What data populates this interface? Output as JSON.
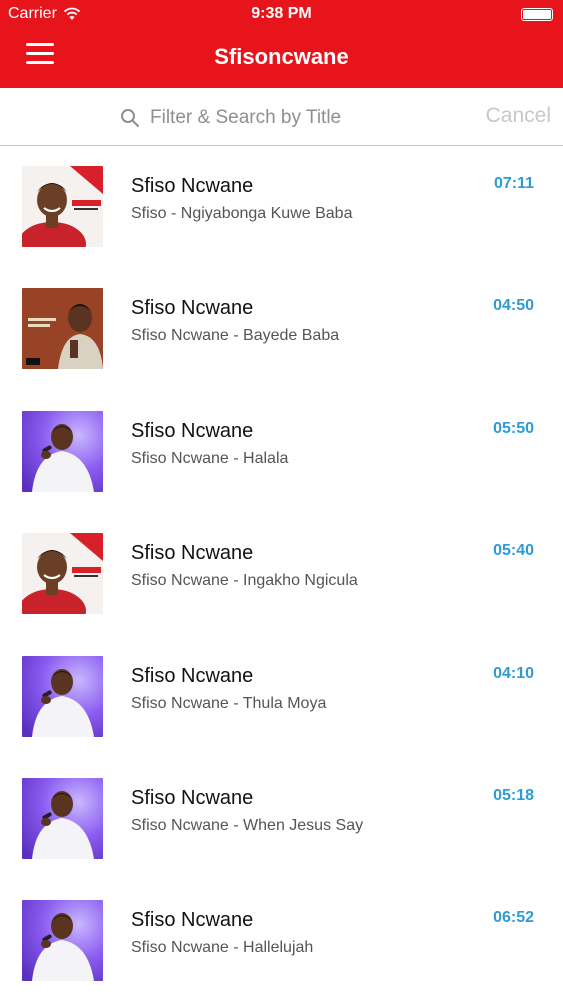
{
  "status_bar": {
    "carrier": "Carrier",
    "time": "9:38 PM"
  },
  "nav": {
    "title": "Sfisoncwane",
    "menu_icon": "hamburger-menu-icon",
    "background_color": "#e8141b"
  },
  "search": {
    "placeholder": "Filter & Search by Title",
    "value": "",
    "cancel_label": "Cancel"
  },
  "accent_color": "#2d9bd6",
  "songs": [
    {
      "artist": "Sfiso Ncwane",
      "title": "Sfiso - Ngiyabonga Kuwe Baba",
      "duration": "07:11",
      "cover": "album-cover-red"
    },
    {
      "artist": "Sfiso Ncwane",
      "title": "Sfiso Ncwane - Bayede Baba",
      "duration": "04:50",
      "cover": "album-cover-brown"
    },
    {
      "artist": "Sfiso Ncwane",
      "title": "Sfiso Ncwane - Halala",
      "duration": "05:50",
      "cover": "album-cover-purple"
    },
    {
      "artist": "Sfiso Ncwane",
      "title": "Sfiso Ncwane - Ingakho Ngicula",
      "duration": "05:40",
      "cover": "album-cover-red"
    },
    {
      "artist": "Sfiso Ncwane",
      "title": "Sfiso Ncwane - Thula Moya",
      "duration": "04:10",
      "cover": "album-cover-purple"
    },
    {
      "artist": "Sfiso Ncwane",
      "title": "Sfiso Ncwane - When Jesus Say",
      "duration": "05:18",
      "cover": "album-cover-purple"
    },
    {
      "artist": "Sfiso Ncwane",
      "title": "Sfiso Ncwane - Hallelujah",
      "duration": "06:52",
      "cover": "album-cover-purple"
    }
  ]
}
